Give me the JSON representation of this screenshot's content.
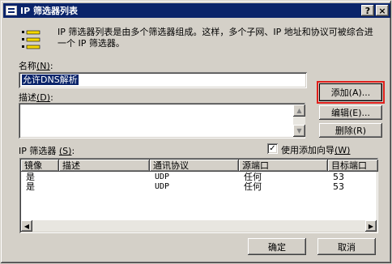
{
  "window": {
    "title": "IP 筛选器列表",
    "help_button": "?",
    "close_button": "×"
  },
  "description": "IP 筛选器列表是由多个筛选器组成。这样，多个子网、IP 地址和协议可被综合进一个 IP 筛选器。",
  "name_label": "名称",
  "name_key": "(N)",
  "name_value": "允许DNS解析",
  "desc_label": "描述",
  "desc_key": "(D)",
  "desc_value": "",
  "buttons": {
    "add": "添加(A)...",
    "edit": "编辑(E)...",
    "remove": "删除(R)",
    "ok": "确定",
    "cancel": "取消"
  },
  "filters_label": "IP 筛选器",
  "filters_key": "(S)",
  "use_wizard_label": "使用添加向导",
  "use_wizard_key": "(W)",
  "use_wizard_checked": true,
  "check_mark": "✓",
  "table": {
    "columns": [
      "镜像",
      "描述",
      "通讯协议",
      "源端口",
      "目标端口"
    ],
    "rows": [
      [
        "是",
        "",
        "UDP",
        "任何",
        "53"
      ],
      [
        "是",
        "",
        "UDP",
        "任何",
        "53"
      ]
    ]
  },
  "icons": {
    "filter": "filter-list-icon",
    "scroll_up": "▲",
    "scroll_down": "▼",
    "scroll_left": "◀",
    "scroll_right": "▶"
  },
  "colors": {
    "titlebar": "#0a246a",
    "selection": "#0a246a",
    "highlight_box": "#e0201c",
    "dialog": "#d4d0c8"
  }
}
